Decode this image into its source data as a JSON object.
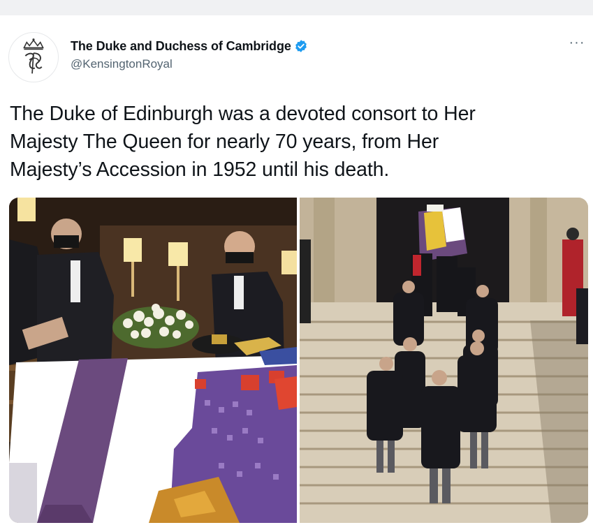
{
  "account": {
    "display_name": "The Duke and Duchess of Cambridge",
    "handle": "@KensingtonRoyal",
    "verified_icon": "verified-badge-icon",
    "avatar_icon": "royal-cypher-monogram",
    "verified_color": "#1d9bf0"
  },
  "menu": {
    "more_label": "···",
    "more_icon": "more-options-icon"
  },
  "tweet": {
    "text": "The Duke of Edinburgh was a devoted consort to Her\nMajesty The Queen for nearly 70 years, from Her\nMajesty’s Accession in 1952 until his death."
  },
  "media": {
    "count": 2
  },
  "colors": {
    "text_primary": "#0f1419",
    "text_secondary": "#536471",
    "background": "#ffffff"
  }
}
